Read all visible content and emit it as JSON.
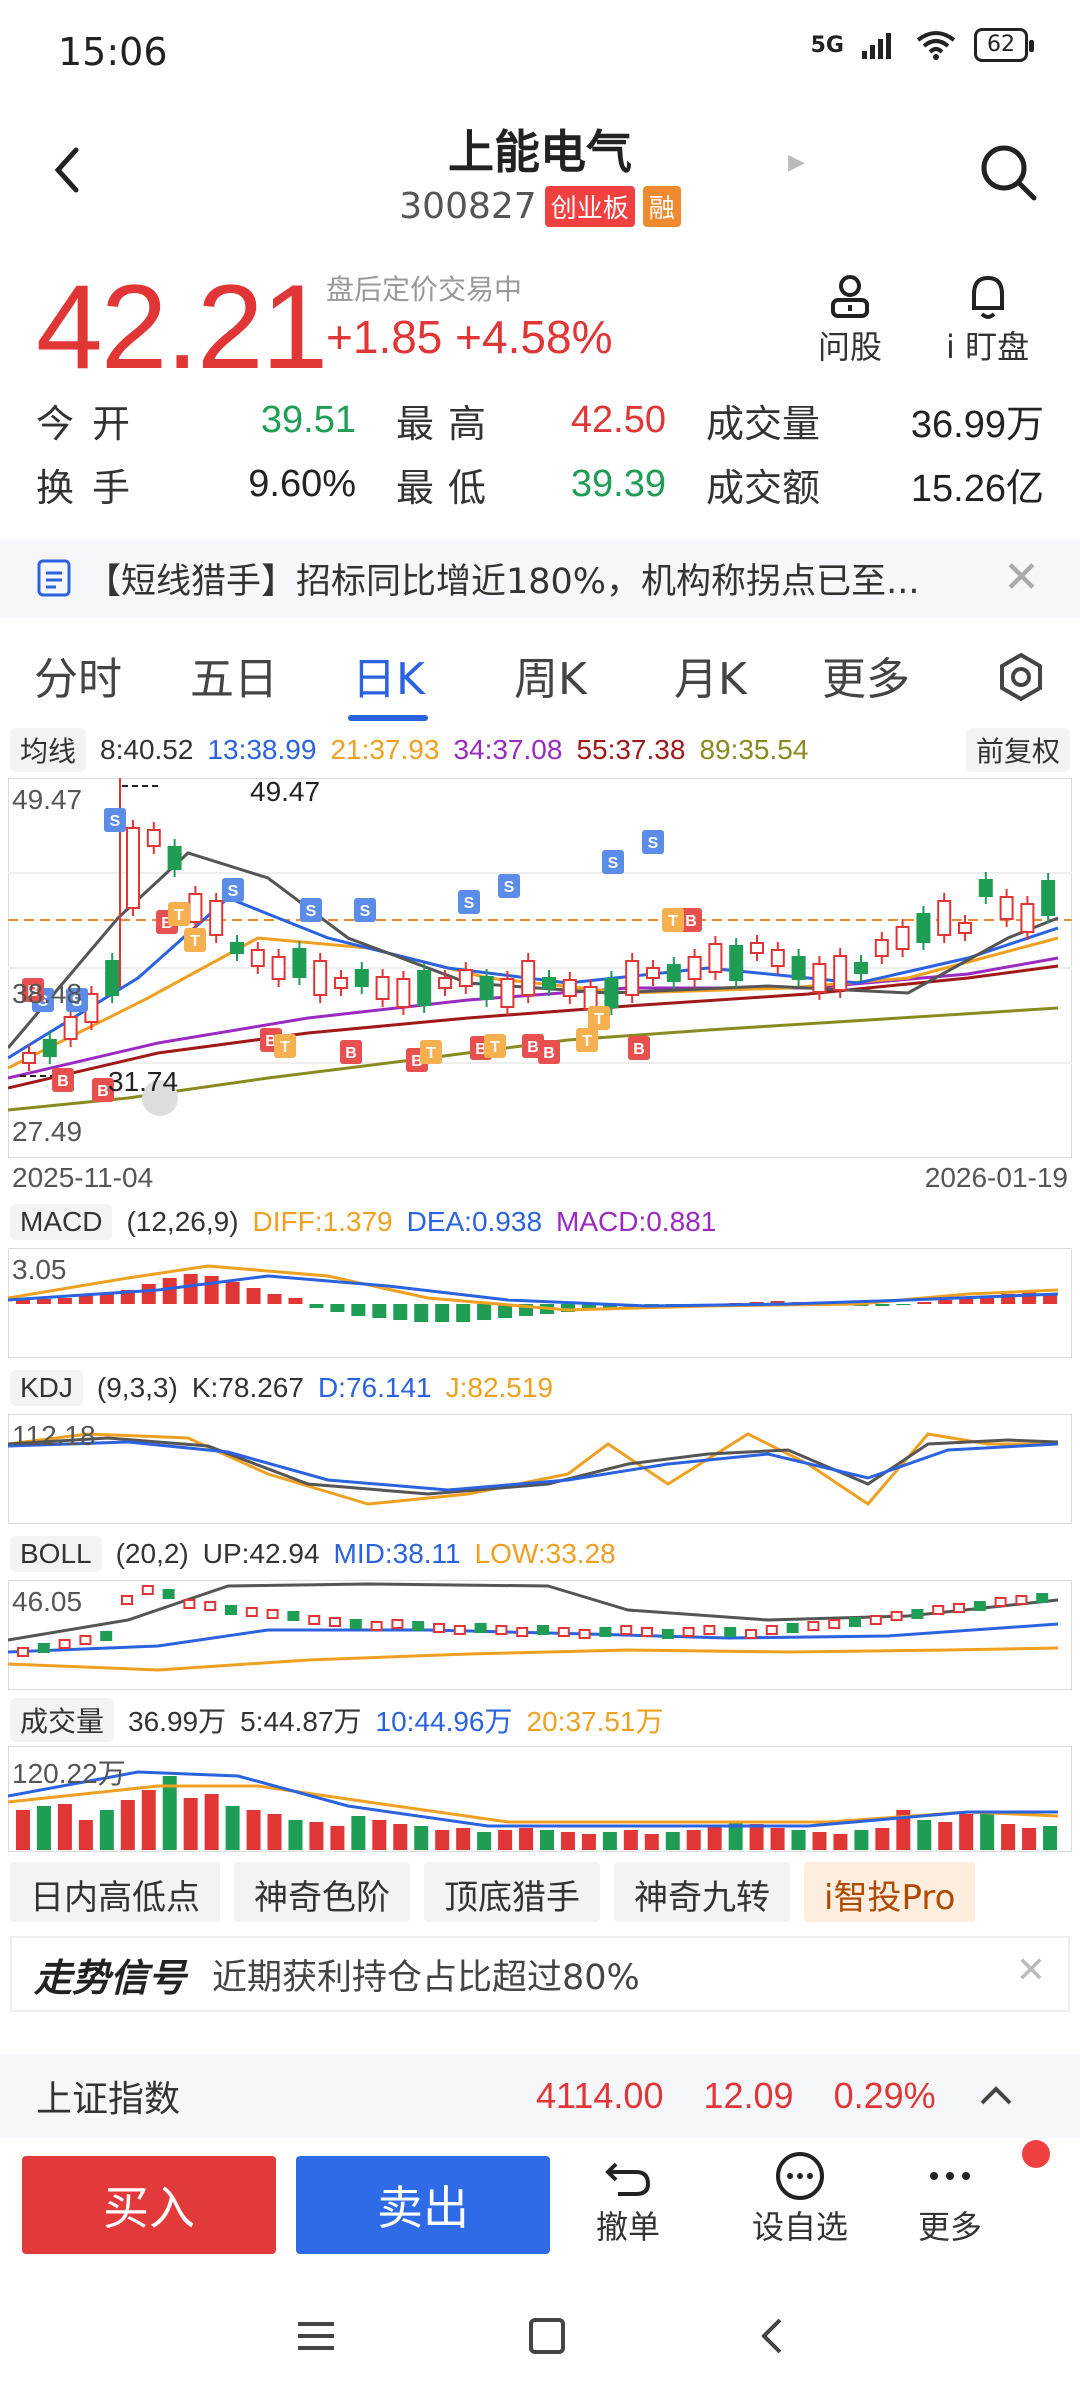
{
  "status": {
    "time": "15:06",
    "network": "5G",
    "battery": "62"
  },
  "header": {
    "name": "上能电气",
    "code": "300827",
    "board_tag": "创业板",
    "margin_tag": "融"
  },
  "quote": {
    "price": "42.21",
    "trade_status": "盘后定价交易中",
    "change": "+1.85 +4.58%",
    "ask_label": "问股",
    "watch_label": "i 盯盘",
    "rows": [
      {
        "l1": "今开",
        "v1": "39.51",
        "l2": "最高",
        "v2": "42.50",
        "l3": "成交量",
        "v3": "36.99万"
      },
      {
        "l1": "换手",
        "v1": "9.60%",
        "l2": "最低",
        "v2": "39.39",
        "l3": "成交额",
        "v3": "15.26亿"
      }
    ]
  },
  "news": {
    "text": "【短线猎手】招标同比增近180%，机构称拐点已至..."
  },
  "tabs": [
    "分时",
    "五日",
    "日K",
    "周K",
    "月K",
    "更多"
  ],
  "ma": {
    "label": "均线",
    "items": [
      {
        "text": "8:40.52",
        "color": "#333333"
      },
      {
        "text": "13:38.99",
        "color": "#2a62e0"
      },
      {
        "text": "21:37.93",
        "color": "#f0a020"
      },
      {
        "text": "34:37.08",
        "color": "#9a2ac0"
      },
      {
        "text": "55:37.38",
        "color": "#a01818"
      },
      {
        "text": "89:35.54",
        "color": "#8a8a20"
      }
    ],
    "adjust": "前复权"
  },
  "kchart": {
    "high_label": "49.47",
    "mid_label": "38.48",
    "low_label": "27.49",
    "peak_annot": "49.47",
    "trough_annot": "31.74",
    "start_date": "2025-11-04",
    "end_date": "2026-01-19"
  },
  "macd": {
    "label": "MACD",
    "params": "(12,26,9)",
    "diff": "DIFF:1.379",
    "dea": "DEA:0.938",
    "macd": "MACD:0.881",
    "top": "3.05"
  },
  "kdj": {
    "label": "KDJ",
    "params": "(9,3,3)",
    "k": "K:78.267",
    "d": "D:76.141",
    "j": "J:82.519",
    "top": "112.18"
  },
  "boll": {
    "label": "BOLL",
    "params": "(20,2)",
    "up": "UP:42.94",
    "mid": "MID:38.11",
    "low": "LOW:33.28",
    "top": "46.05"
  },
  "volume": {
    "label": "成交量",
    "v": "36.99万",
    "v5": "5:44.87万",
    "v10": "10:44.96万",
    "v20": "20:37.51万",
    "top": "120.22万"
  },
  "features": [
    "日内高低点",
    "神奇色阶",
    "顶底猎手",
    "神奇九转",
    "i智投Pro"
  ],
  "signal": {
    "title": "走势信号",
    "text": "近期获利持仓占比超过80%"
  },
  "index": {
    "name": "上证指数",
    "value": "4114.00",
    "change": "12.09",
    "pct": "0.29%"
  },
  "actions": {
    "buy": "买入",
    "sell": "卖出",
    "cancel": "撤单",
    "watchlist": "设自选",
    "more": "更多"
  }
}
